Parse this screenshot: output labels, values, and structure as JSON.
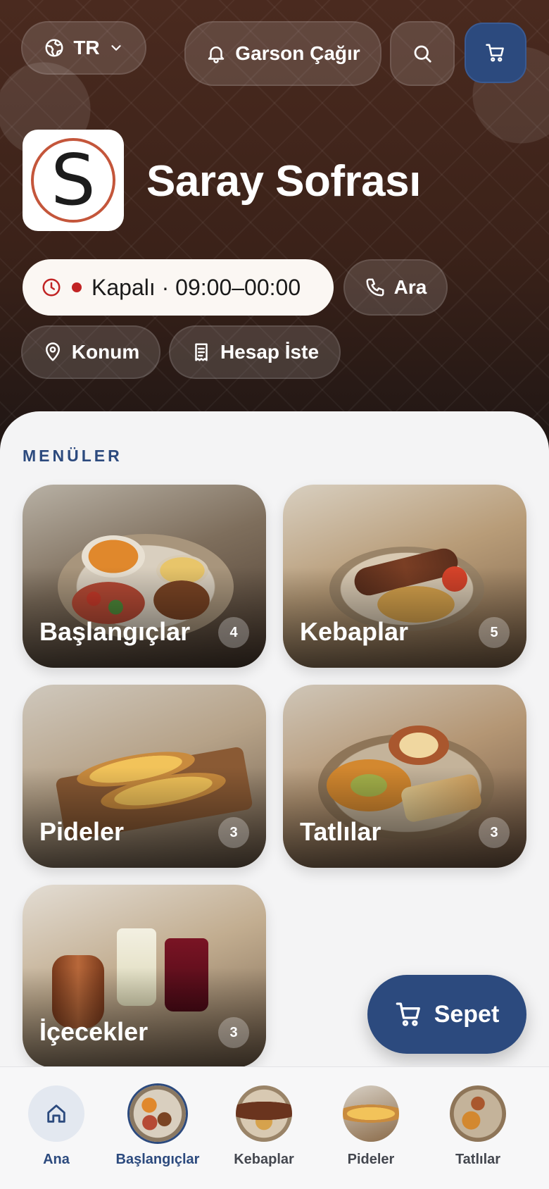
{
  "header": {
    "language": "TR",
    "waiter_label": "Garson Çağır",
    "restaurant_name": "Saray Sofrası",
    "logo_letter": "S",
    "status": "Kapalı · 09:00–00:00",
    "call_label": "Ara",
    "location_label": "Konum",
    "bill_label": "Hesap İste"
  },
  "menus": {
    "title": "MENÜLER",
    "items": [
      {
        "name": "Başlangıçlar",
        "count": "4"
      },
      {
        "name": "Kebaplar",
        "count": "5"
      },
      {
        "name": "Pideler",
        "count": "3"
      },
      {
        "name": "Tatlılar",
        "count": "3"
      },
      {
        "name": "İçecekler",
        "count": "3"
      }
    ]
  },
  "cart_button": {
    "label": "Sepet"
  },
  "bottom_nav": {
    "items": [
      {
        "label": "Ana"
      },
      {
        "label": "Başlangıçlar"
      },
      {
        "label": "Kebaplar"
      },
      {
        "label": "Pideler"
      },
      {
        "label": "Tatlılar"
      }
    ]
  },
  "colors": {
    "accent": "#2c4a7e",
    "status_closed": "#c12424",
    "logo_ring": "#c4563b"
  },
  "icons": {
    "language": "globe-icon",
    "waiter": "bell-icon",
    "search": "search-icon",
    "cart": "cart-icon",
    "clock": "clock-icon",
    "phone": "phone-icon",
    "location": "map-pin-icon",
    "bill": "receipt-icon",
    "home": "home-icon"
  }
}
